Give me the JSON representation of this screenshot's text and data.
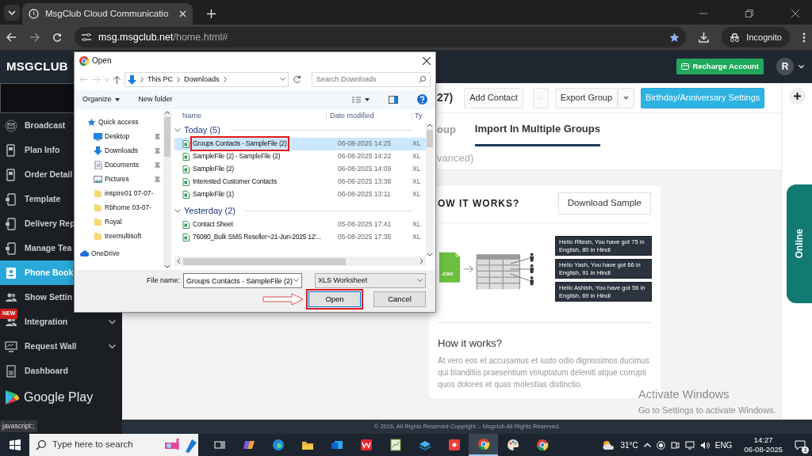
{
  "browser": {
    "tab_title": "MsgClub Cloud Communicatio",
    "url_host": "msg.msgclub.net",
    "url_path": "/home.html#",
    "bookmarked": true,
    "profile": "Incognito"
  },
  "app_header": {
    "logo": "MSGCLUB",
    "recharge_button": "Recharge Account",
    "avatar": "R"
  },
  "sidebar": {
    "items": [
      {
        "label": "Broadcast",
        "selected": false
      },
      {
        "label": "Plan Info",
        "selected": false
      },
      {
        "label": "Order Detail",
        "selected": false
      },
      {
        "label": "Template",
        "selected": false
      },
      {
        "label": "Delivery Rep",
        "selected": false
      },
      {
        "label": "Manage Tea",
        "selected": false
      },
      {
        "label": "Phone Book",
        "selected": true
      },
      {
        "label": "Show Settin",
        "selected": false
      },
      {
        "label": "Integration",
        "selected": false,
        "badge": "NEW",
        "expandable": true
      },
      {
        "label": "Request Wall",
        "selected": false,
        "expandable": true
      },
      {
        "label": "Dashboard",
        "selected": false
      }
    ],
    "store_badge": "Google Play"
  },
  "toolbar": {
    "count": "27)",
    "buttons": [
      {
        "label": "Add Contact",
        "kind": "plain"
      },
      {
        "label": "...",
        "kind": "more"
      },
      {
        "label": "Export Group",
        "kind": "split"
      },
      {
        "label": "Birthday/Anniversary Settings",
        "kind": "primary"
      }
    ]
  },
  "tabs": [
    {
      "label": "oup",
      "selected": false
    },
    {
      "label": "Import In Multiple Groups",
      "selected": true
    }
  ],
  "subtab": "vanced)",
  "card": {
    "title": "OW IT WORKS?",
    "download_button": "Download Sample",
    "file_label": ".csv",
    "messages": [
      "Hello Ritesh, You have got 75 in English, 80 in Hindi",
      "Hello Yash, You have got 66 in English, 91 in Hindi",
      "Hello Ashish, You have got 56 in English, 69 in Hindi"
    ],
    "heading": "How it works?",
    "body": "At vero eos et accusamus et iusto odio dignissimos ducimus qui blanditiis praesentium voluptatum deleniti atque corrupti quos dolores et quas molestias distinctio."
  },
  "online_tab": "Online",
  "footer": "© 2016, All Rights Reserved Copyright :- Msgclub All Rights Reserved.",
  "status_text": "javascript:;",
  "activation": {
    "title": "Activate Windows",
    "hint": "Go to Settings to activate Windows."
  },
  "dialog": {
    "title": "Open",
    "path": [
      "This PC",
      "Downloads"
    ],
    "search_placeholder": "Search Downloads",
    "commands": [
      "Organize",
      "New folder"
    ],
    "nav": [
      {
        "label": "Quick access",
        "kind": "star",
        "children": [
          {
            "label": "Desktop",
            "kind": "desktop",
            "pinned": true
          },
          {
            "label": "Downloads",
            "kind": "downloads",
            "pinned": true
          },
          {
            "label": "Documents",
            "kind": "documents",
            "pinned": true
          },
          {
            "label": "Pictures",
            "kind": "pictures",
            "pinned": true
          },
          {
            "label": "inspire01 07-07-",
            "kind": "folder",
            "pinned": false
          },
          {
            "label": "Rbhome 03-07-",
            "kind": "folder",
            "pinned": false
          },
          {
            "label": "Royal",
            "kind": "folder",
            "pinned": false
          },
          {
            "label": "treemultisoft",
            "kind": "folder",
            "pinned": false
          }
        ]
      },
      {
        "label": "OneDrive",
        "kind": "cloud"
      }
    ],
    "columns": [
      "Name",
      "Date modified",
      "Ty"
    ],
    "groups": [
      {
        "label": "Today (5)",
        "expanded": true,
        "files": [
          {
            "name": "Groups Contacts - SampleFile (2)",
            "date": "06-08-2025 14:25",
            "type": "XL",
            "selected": true,
            "marked": true
          },
          {
            "name": "SampleFile (2) - SampleFile (2)",
            "date": "06-08-2025 14:22",
            "type": "XL",
            "selected": false,
            "marked": false
          },
          {
            "name": "SampleFile (2)",
            "date": "06-08-2025 14:09",
            "type": "XL",
            "selected": false,
            "marked": false
          },
          {
            "name": "Interested Customer Contacts",
            "date": "06-08-2025 13:38",
            "type": "XL",
            "selected": false,
            "marked": false
          },
          {
            "name": "SampleFile (1)",
            "date": "06-08-2025 13:11",
            "type": "XL",
            "selected": false,
            "marked": false
          }
        ]
      },
      {
        "label": "Yesterday (2)",
        "expanded": true,
        "files": [
          {
            "name": "Contact Sheet",
            "date": "05-08-2025 17:41",
            "type": "XL",
            "selected": false,
            "marked": false
          },
          {
            "name": "76080_Bulk SMS Reseller~21-Jun-2025 12'...",
            "date": "05-08-2025 17:35",
            "type": "XL",
            "selected": false,
            "marked": false
          }
        ]
      }
    ],
    "file_name_label": "File name:",
    "file_name": "Groups Contacts - SampleFile (2)",
    "file_type": "XLS Worksheet",
    "buttons": [
      {
        "label": "Open",
        "kind": "default",
        "marked": true
      },
      {
        "label": "Cancel",
        "kind": "normal",
        "marked": false
      }
    ]
  },
  "taskbar": {
    "search_placeholder": "Type here to search",
    "apps": [
      {
        "active": false
      },
      {
        "active": false
      },
      {
        "active": false
      },
      {
        "active": false
      },
      {
        "active": false
      },
      {
        "active": false
      },
      {
        "active": false
      },
      {
        "active": false
      },
      {
        "active": false
      },
      {
        "active": true
      },
      {
        "active": false
      },
      {
        "active": false
      }
    ],
    "weather": "31°C",
    "language": "ENG",
    "time": "14:27",
    "date": "06-08-2025",
    "notifications": "3"
  }
}
